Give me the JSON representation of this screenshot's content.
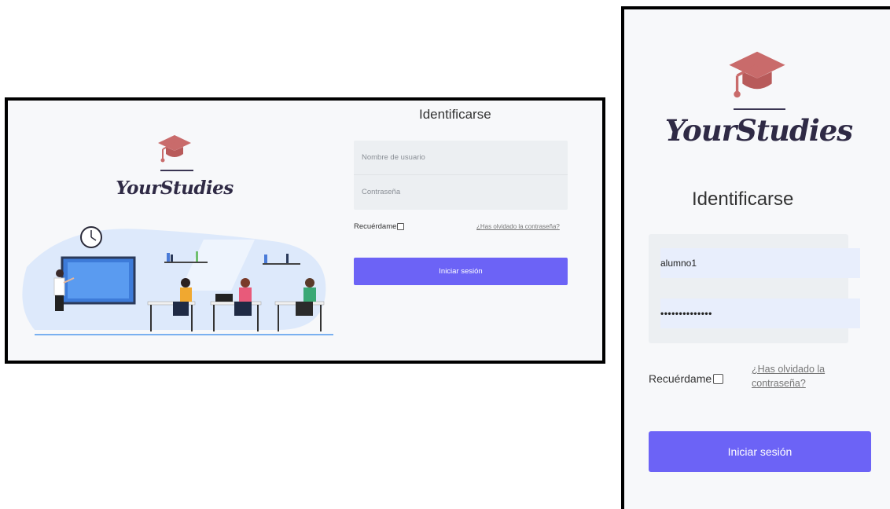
{
  "desktop": {
    "title": "Identificarse",
    "logo_text": "YourStudies",
    "username": {
      "placeholder": "Nombre de usuario",
      "value": ""
    },
    "password": {
      "placeholder": "Contraseña",
      "value": ""
    },
    "remember_label": "Recuérdame",
    "forgot_link": "¿Has olvidado la contraseña?",
    "submit_label": "Iniciar sesión"
  },
  "mobile": {
    "title": "Identificarse",
    "logo_text": "YourStudies",
    "username": {
      "value": "alumno1"
    },
    "password": {
      "value": "••••••••••••••"
    },
    "remember_label": "Recuérdame",
    "forgot_link": "¿Has olvidado la contraseña?",
    "submit_label": "Iniciar sesión"
  },
  "colors": {
    "accent": "#6c63f6",
    "logo_cap": "#c96b6b",
    "logo_text": "#2f2a45",
    "panel_bg": "#f7f8fa",
    "field_bg": "#eceff2"
  },
  "icons": [
    "graduation-cap-icon",
    "classroom-illustration",
    "clock-icon"
  ]
}
